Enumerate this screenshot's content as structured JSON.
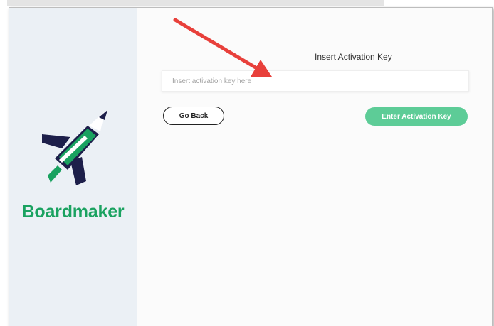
{
  "brand": {
    "name": "Boardmaker",
    "logo_icon": "rocket-pencil-icon",
    "color": "#1aa260"
  },
  "activation": {
    "heading": "Insert Activation Key",
    "input_placeholder": "Insert activation key here",
    "input_value": ""
  },
  "buttons": {
    "back_label": "Go Back",
    "enter_label": "Enter Activation Key"
  },
  "annotation": {
    "icon": "red-arrow-icon",
    "color": "#e8403b"
  },
  "colors": {
    "sidebar_bg": "#ebf0f5",
    "accent_green": "#5dcc97",
    "logo_navy": "#1d1f4a"
  }
}
